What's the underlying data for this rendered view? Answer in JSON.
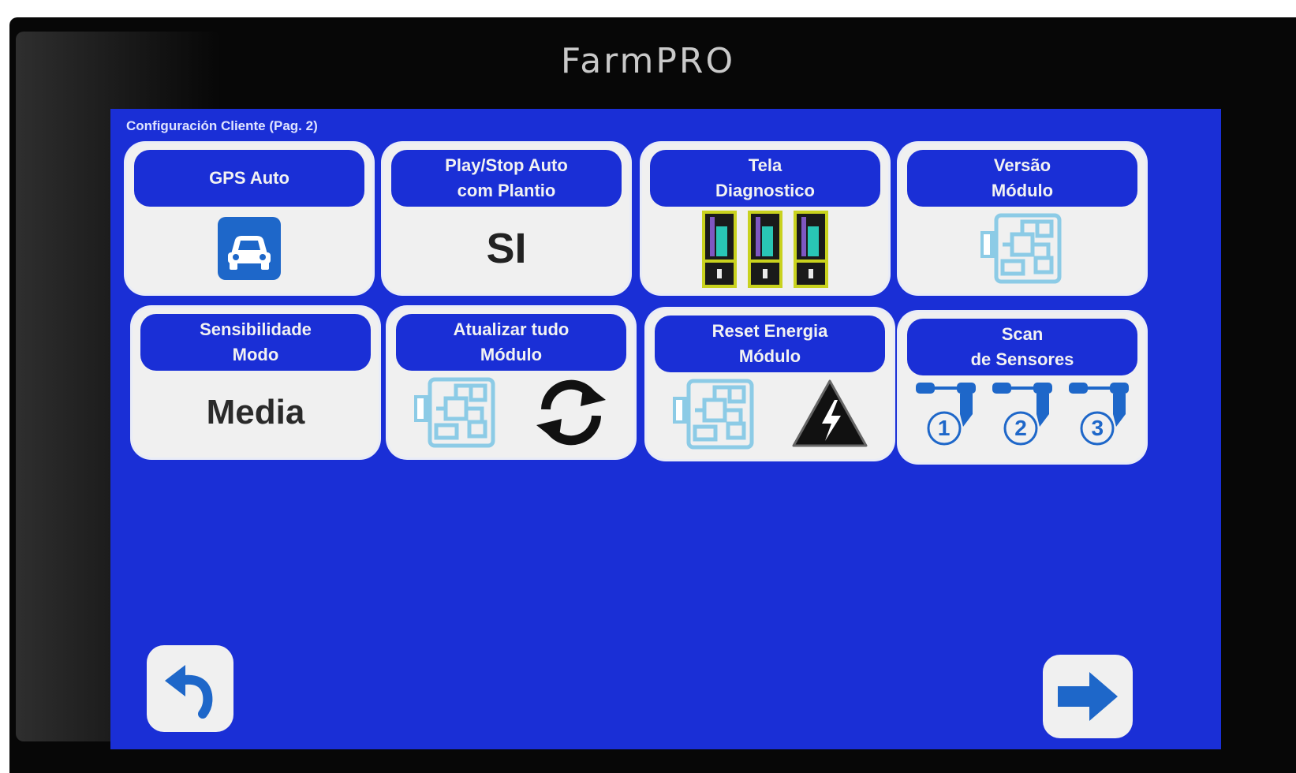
{
  "brand": "FarmPRO",
  "screen": {
    "title": "Configuración Cliente (Pag. 2)"
  },
  "tiles": [
    {
      "label": "GPS Auto",
      "icon": "car-icon"
    },
    {
      "label": "Play/Stop Auto\ncom Plantio",
      "value": "SI"
    },
    {
      "label": "Tela\nDiagnostico",
      "icon": "diagnostic-bars-icon"
    },
    {
      "label": "Versão\nMódulo",
      "icon": "circuit-board-icon"
    },
    {
      "label": "Sensibilidade\nModo",
      "value": "Media"
    },
    {
      "label": "Atualizar tudo\nMódulo",
      "icon": "refresh-icon"
    },
    {
      "label": "Reset Energia\nMódulo",
      "icon": "high-voltage-icon"
    },
    {
      "label": "Scan\nde Sensores",
      "sensors": [
        "1",
        "2",
        "3"
      ]
    }
  ],
  "nav": {
    "back_icon": "back-arrow-icon",
    "next_icon": "next-arrow-icon"
  },
  "colors": {
    "screen_bg": "#1a2fd6",
    "tile_bg": "#f0f0f0",
    "icon_blue": "#1e67c9",
    "board_light": "#8ccbe6"
  }
}
